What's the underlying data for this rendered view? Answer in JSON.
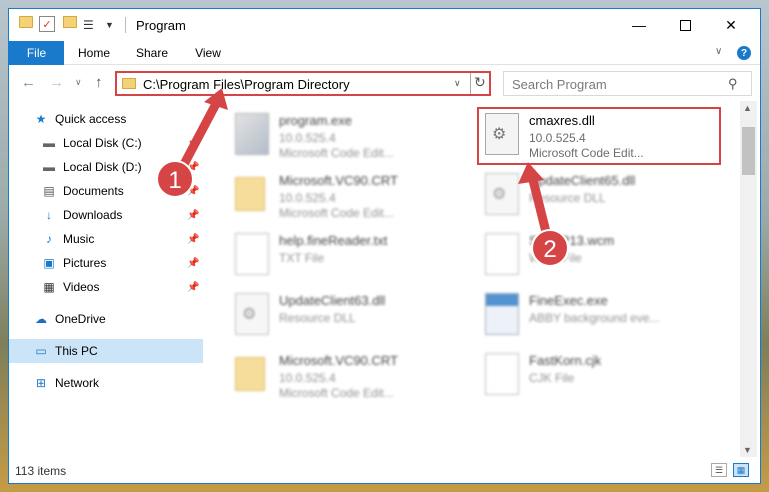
{
  "window": {
    "title": "Program",
    "quick_access_icons": [
      "folder-icon",
      "properties-check-icon",
      "new-folder-icon",
      "customize-icon"
    ]
  },
  "ribbon": {
    "tabs": [
      {
        "label": "File",
        "active": true
      },
      {
        "label": "Home"
      },
      {
        "label": "Share"
      },
      {
        "label": "View"
      }
    ],
    "accent_color": "#1979ca"
  },
  "address": {
    "path": "C:\\Program Files\\Program Directory",
    "search_placeholder": "Search Program"
  },
  "sidebar": {
    "items": [
      {
        "label": "Quick access",
        "icon": "star-icon"
      },
      {
        "label": "Local Disk (C:)",
        "icon": "drive-icon",
        "pinned": true
      },
      {
        "label": "Local Disk (D:)",
        "icon": "drive-icon",
        "pinned": true
      },
      {
        "label": "Documents",
        "icon": "documents-icon",
        "pinned": true
      },
      {
        "label": "Downloads",
        "icon": "downloads-icon",
        "pinned": true
      },
      {
        "label": "Music",
        "icon": "music-icon",
        "pinned": true
      },
      {
        "label": "Pictures",
        "icon": "pictures-icon",
        "pinned": true
      },
      {
        "label": "Videos",
        "icon": "videos-icon",
        "pinned": true
      },
      {
        "label": "OneDrive",
        "icon": "onedrive-icon"
      },
      {
        "label": "This PC",
        "icon": "this-pc-icon",
        "selected": true
      },
      {
        "label": "Network",
        "icon": "network-icon"
      }
    ]
  },
  "files": [
    {
      "name": "program.exe",
      "line1": "10.0.525.4",
      "line2": "Microsoft Code Edit...",
      "icon": "exe-icon"
    },
    {
      "name": "cmaxres.dll",
      "line1": "10.0.525.4",
      "line2": "Microsoft Code Edit...",
      "icon": "dll-gear-icon",
      "highlighted": true
    },
    {
      "name": "Microsoft.VC90.CRT",
      "line1": "10.0.525.4",
      "line2": "Microsoft Code Edit...",
      "icon": "folder-icon"
    },
    {
      "name": "UpdateClient65.dll",
      "line1": "Resource DLL",
      "line2": "",
      "icon": "dll-gear-icon"
    },
    {
      "name": "help.fineReader.txt",
      "line1": "TXT File",
      "line2": "",
      "icon": "text-file-icon"
    },
    {
      "name": "SWMP13.wcm",
      "line1": "WCM File",
      "line2": "",
      "icon": "file-icon"
    },
    {
      "name": "UpdateClient63.dll",
      "line1": "Resource DLL",
      "line2": "",
      "icon": "dll-gear-icon"
    },
    {
      "name": "FineExec.exe",
      "line1": "ABBY background eve...",
      "line2": "",
      "icon": "app-window-icon"
    },
    {
      "name": "Microsoft.VC90.CRT",
      "line1": "10.0.525.4",
      "line2": "Microsoft Code Edit...",
      "icon": "folder-icon"
    },
    {
      "name": "FastKorn.cjk",
      "line1": "CJK File",
      "line2": "",
      "icon": "file-icon"
    }
  ],
  "status": {
    "item_count": "113 items"
  },
  "annotations": {
    "badges": [
      "1",
      "2"
    ],
    "color": "#d64545"
  }
}
